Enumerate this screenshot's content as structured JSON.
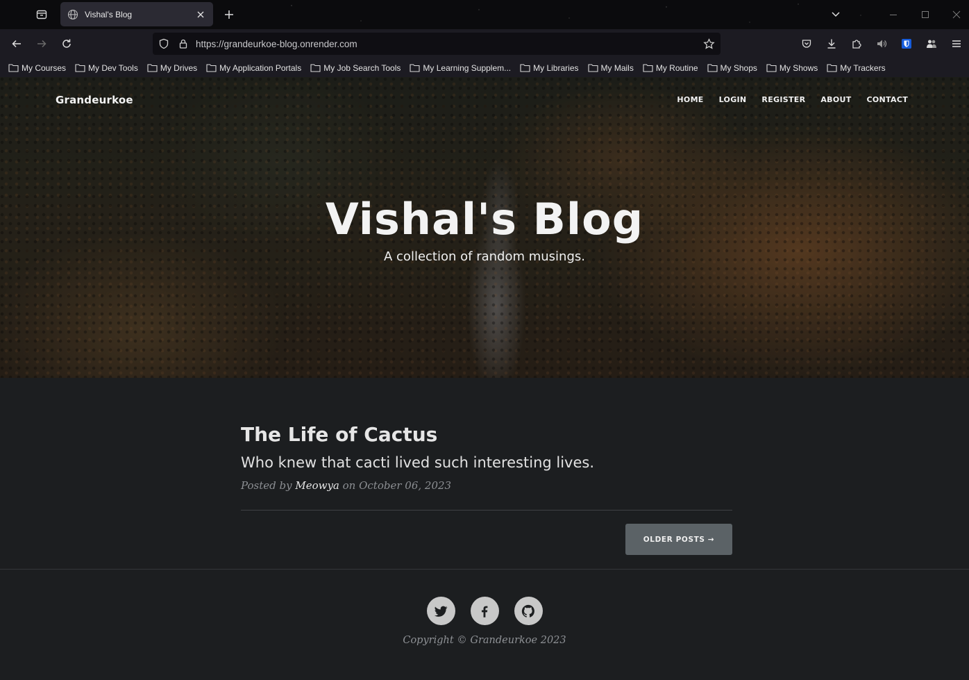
{
  "browser": {
    "tab_title": "Vishal's Blog",
    "url": "https://grandeurkoe-blog.onrender.com",
    "bookmarks": [
      "My Courses",
      "My Dev Tools",
      "My Drives",
      "My Application Portals",
      "My Job Search Tools",
      "My Learning Supplem...",
      "My Libraries",
      "My Mails",
      "My Routine",
      "My Shops",
      "My Shows",
      "My Trackers"
    ],
    "icons": [
      "tab-overview-icon",
      "globe-icon",
      "close-icon",
      "new-tab-icon",
      "tab-list-icon",
      "minimize-icon",
      "maximize-icon",
      "window-close-icon",
      "back-icon",
      "forward-icon",
      "reload-icon",
      "shield-icon",
      "lock-icon",
      "star-icon",
      "pocket-icon",
      "download-icon",
      "extensions-icon",
      "speaker-icon",
      "bitwarden-icon",
      "account-icon",
      "menu-icon",
      "folder-icon"
    ]
  },
  "site": {
    "brand": "Grandeurkoe",
    "nav": [
      "HOME",
      "LOGIN",
      "REGISTER",
      "ABOUT",
      "CONTACT"
    ],
    "hero_title": "Vishal's Blog",
    "hero_subtitle": "A collection of random musings."
  },
  "post": {
    "title": "The Life of Cactus",
    "subtitle": "Who knew that cacti lived such interesting lives.",
    "meta_prefix": "Posted by ",
    "author": "Meowya",
    "meta_date": " on October 06, 2023"
  },
  "pager": {
    "older_label": "OLDER POSTS →"
  },
  "footer": {
    "social_icons": [
      "twitter-icon",
      "facebook-icon",
      "github-icon"
    ],
    "copyright": "Copyright © Grandeurkoe 2023"
  }
}
